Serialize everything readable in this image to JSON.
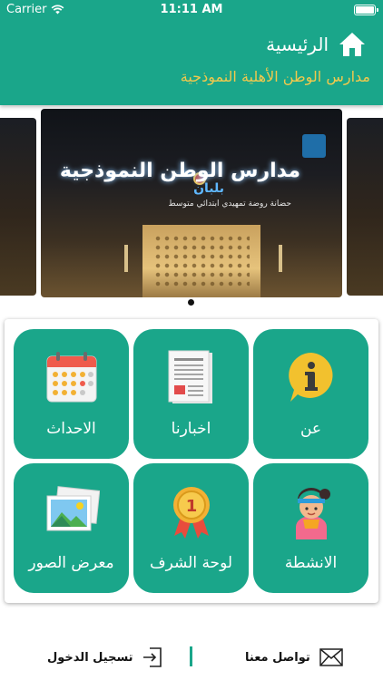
{
  "status_bar": {
    "carrier": "Carrier",
    "time": "11:11 AM"
  },
  "header": {
    "title": "الرئيسية",
    "subtitle": "مدارس الوطن الأهلية النموذجية",
    "bg_color": "#1aa68a",
    "subtitle_color": "#f2c94c"
  },
  "carousel": {
    "sign_title": "مدارس الوطن النموذجية",
    "sign_subtitle": "بلبان",
    "sign_line": "حضانة روضة تمهيدي ابتدائي متوسط",
    "active_page": 1,
    "page_count": 1
  },
  "grid": {
    "tiles": [
      {
        "label": "عن",
        "icon": "info-icon"
      },
      {
        "label": "اخبارنا",
        "icon": "newspaper-icon"
      },
      {
        "label": "الاحداث",
        "icon": "calendar-icon"
      },
      {
        "label": "الانشطة",
        "icon": "athlete-icon"
      },
      {
        "label": "لوحة الشرف",
        "icon": "medal-icon"
      },
      {
        "label": "معرض الصور",
        "icon": "gallery-icon"
      }
    ]
  },
  "footer": {
    "contact_label": "تواصل معنا",
    "login_label": "تسجيل الدخول",
    "accent": "#1aa68a"
  }
}
